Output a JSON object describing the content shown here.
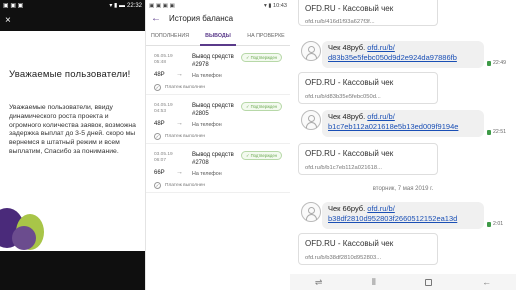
{
  "panel1": {
    "status": {
      "left_icons": "▣ ▣ ▣",
      "time": "22:32",
      "right_icons": "▾ ▮ ▬"
    },
    "close": "×",
    "title": "Уважаемые пользователи!",
    "message": "Уважаемые пользователи, ввиду динамического роста проекта и огромного количества заявок, возможна задержка выплат до 3-5 дней. скоро мы вернемся в штатный режим и всем выплатим, Спасибо за понимание."
  },
  "panel2": {
    "status": {
      "left": "▣ ▣ ▣ ▣",
      "right": "▾ ▮ 10:43"
    },
    "title": "История баланса",
    "tabs": [
      "ПОПОЛНЕНИЯ",
      "ВЫВОДЫ",
      "НА ПРОВЕРКЕ"
    ],
    "operations": [
      {
        "date": "06.05.19",
        "time": "05:48",
        "name": "Вывод средств",
        "number": "#2978",
        "badge": "Подтвержден",
        "amount": "48Р",
        "dest": "На телефон",
        "status": "Платеж выполнен"
      },
      {
        "date": "04.05.19",
        "time": "04:53",
        "name": "Вывод средств",
        "number": "#2805",
        "badge": "Подтвержден",
        "amount": "48Р",
        "dest": "На телефон",
        "status": "Платеж выполнен"
      },
      {
        "date": "03.05.19",
        "time": "06:07",
        "name": "Вывод средств",
        "number": "#2708",
        "badge": "Подтвержден",
        "amount": "66Р",
        "dest": "На телефон",
        "status": "Платеж выполнен"
      }
    ]
  },
  "panel3": {
    "top_link": "ofd.ru/b/416d1f93a627f3f...",
    "card_title": "OFD.RU - Кассовый чек",
    "messages": [
      {
        "prefix": "Чек 48руб.",
        "link1": "ofd.ru/b/",
        "link2": "d83b35e5febc050d9d2e924da97886fb",
        "time": "22:49",
        "card_title": "OFD.RU - Кассовый чек",
        "card_url": "ofd.ru/b/d83b35e5febc050d..."
      },
      {
        "prefix": "Чек 48руб.",
        "link1": "ofd.ru/b/",
        "link2": "b1c7eb112a021618e5b13ed009f9194e",
        "time": "22:51",
        "card_title": "OFD.RU - Кассовый чек",
        "card_url": "ofd.ru/b/b1c7eb112a021618..."
      },
      {
        "prefix": "Чек 66руб.",
        "link1": "ofd.ru/b/",
        "link2": "b38df2810d952803f2660512152ea13d",
        "time": "2:01",
        "card_title": "OFD.RU - Кассовый чек",
        "card_url": "ofd.ru/b/b38df2810d952803..."
      }
    ],
    "day_separator": "вторник, 7 мая 2019 г."
  }
}
